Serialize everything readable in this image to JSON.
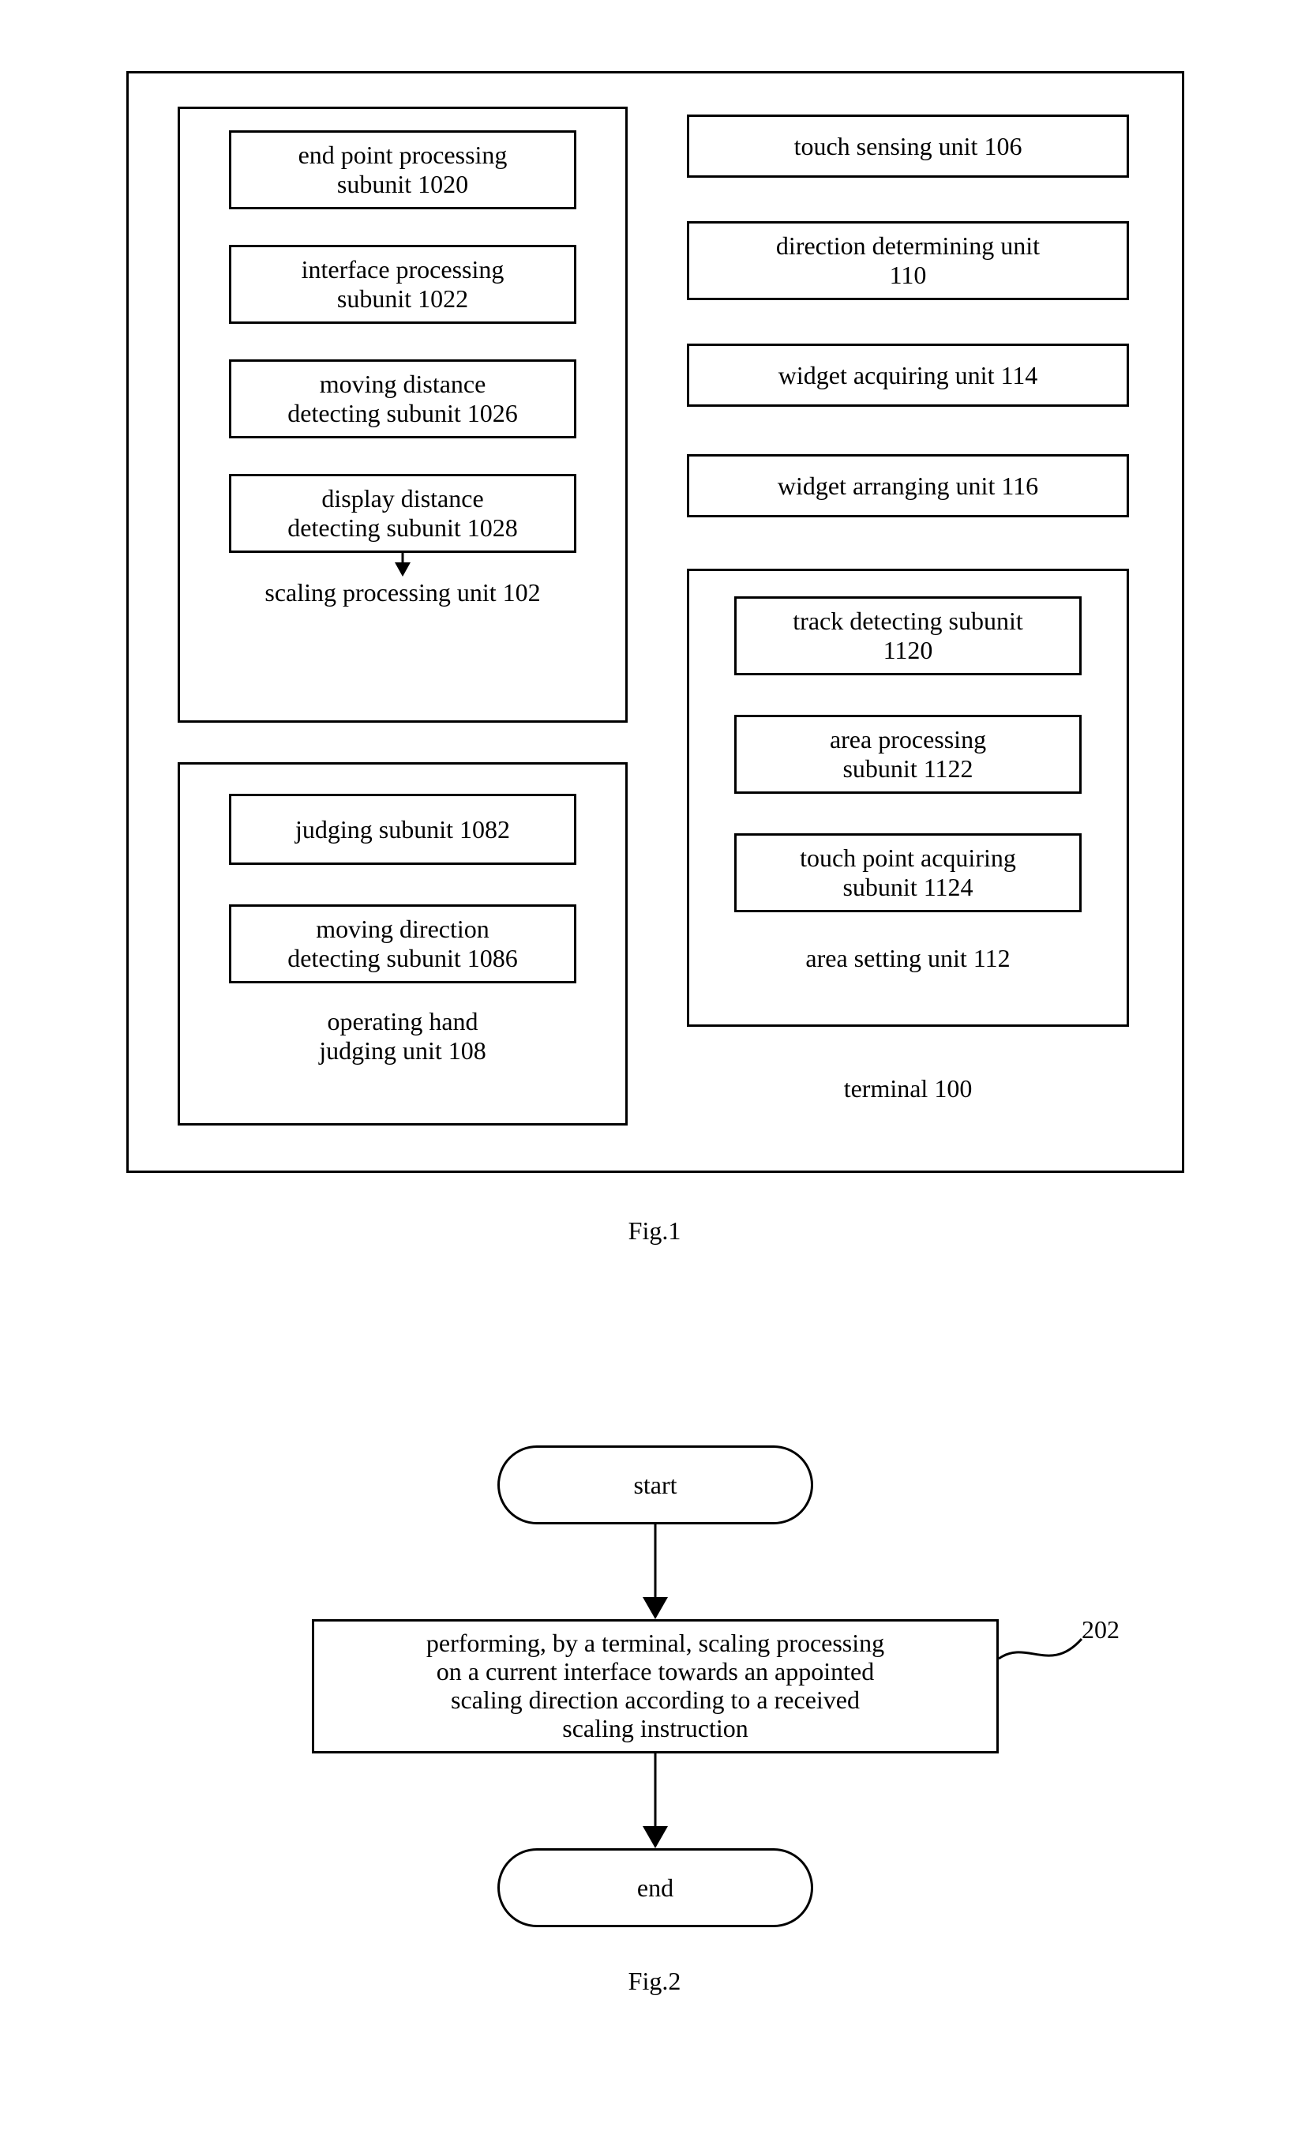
{
  "fig1": {
    "caption": "Fig.1",
    "terminal_label": "terminal 100",
    "left_group": {
      "scaling_unit_label": "scaling processing unit 102",
      "subunits": {
        "endpoint": {
          "l1": "end point processing",
          "l2": "subunit 1020"
        },
        "interface": {
          "l1": "interface processing",
          "l2": "subunit 1022"
        },
        "moving_dist": {
          "l1": "moving distance",
          "l2": "detecting subunit 1026"
        },
        "display_dist": {
          "l1": "display distance",
          "l2": "detecting subunit 1028"
        }
      },
      "operating_hand_label_l1": "operating hand",
      "operating_hand_label_l2": "judging unit 108",
      "operating_subunits": {
        "judging": {
          "l1": "judging subunit 1082"
        },
        "moving_dir": {
          "l1": "moving direction",
          "l2": "detecting subunit 1086"
        }
      }
    },
    "right_group": {
      "touch_sensing": "touch sensing unit 106",
      "direction_det_l1": "direction determining unit",
      "direction_det_l2": "110",
      "widget_acq": "widget acquiring unit 114",
      "widget_arr": "widget arranging unit 116",
      "area_setting_label": "area setting unit 112",
      "area_subunits": {
        "track": {
          "l1": "track detecting subunit",
          "l2": "1120"
        },
        "area_proc": {
          "l1": "area processing",
          "l2": "subunit 1122"
        },
        "touch_pt": {
          "l1": "touch point acquiring",
          "l2": "subunit 1124"
        }
      }
    }
  },
  "fig2": {
    "caption": "Fig.2",
    "start": "start",
    "end": "end",
    "step": {
      "l1": "performing, by a terminal, scaling processing",
      "l2": "on a current interface towards an appointed",
      "l3": "scaling direction according to a received",
      "l4": "scaling instruction"
    },
    "step_ref": "202"
  }
}
